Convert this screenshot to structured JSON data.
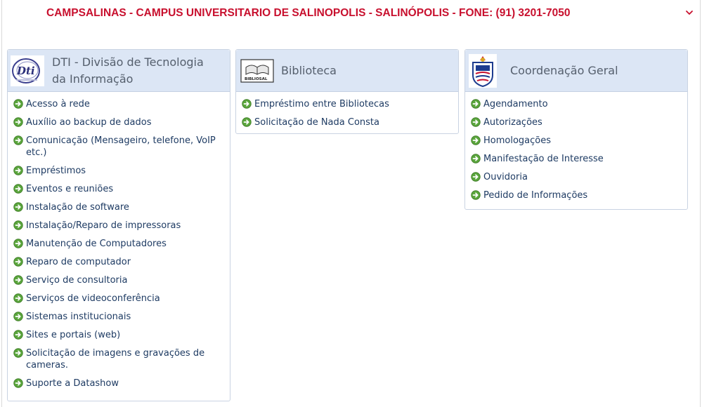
{
  "header": {
    "campus": "CAMPSALINAS - CAMPUS UNIVERSITARIO DE SALINOPOLIS - SALINÓPOLIS - FONE: (91) 3201-7050"
  },
  "panels": [
    {
      "title": "DTI - Divisão de Tecnologia da Informação",
      "logo_text": "Dti",
      "items": [
        "Acesso à rede",
        "Auxílio ao backup de dados",
        "Comunicação (Mensageiro, telefone, VoIP etc.)",
        "Empréstimos",
        "Eventos e reuniões",
        "Instalação de software",
        "Instalação/Reparo de impressoras",
        "Manutenção de Computadores",
        "Reparo de computador",
        "Serviço de consultoria",
        "Serviços de videoconferência",
        "Sistemas institucionais",
        "Sites e portais (web)",
        "Solicitação de imagens e gravações de cameras.",
        "Suporte a Datashow"
      ]
    },
    {
      "title": "Biblioteca",
      "logo_text": "BIBLIOSAL",
      "items": [
        "Empréstimo entre Bibliotecas",
        "Solicitação de Nada Consta"
      ]
    },
    {
      "title": "Coordenação Geral",
      "items": [
        "Agendamento",
        "Autorizações",
        "Homologações",
        "Manifestação de Interesse",
        "Ouvidoria",
        "Pedido de Informações"
      ]
    }
  ],
  "colors": {
    "header_red": "#c8102e",
    "panel_head_bg": "#dce6f5",
    "link_text": "#1e3b63",
    "bullet_green": "#5aa53c"
  },
  "icons": {
    "bullet": "green-circle-arrow-icon",
    "expand": "chevron-down-icon"
  }
}
